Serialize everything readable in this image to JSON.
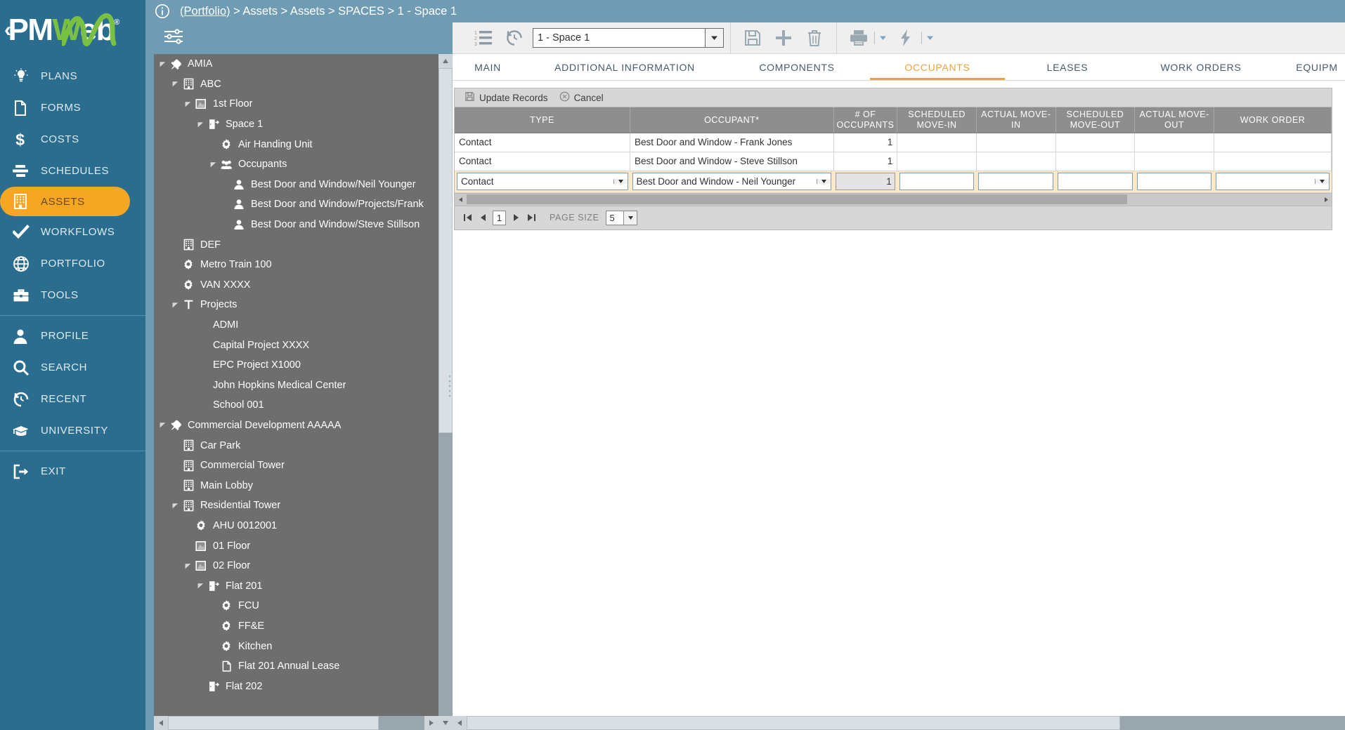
{
  "brand": {
    "name": "PMWeb",
    "chevron": "‹",
    "registered": "®",
    "accent_green": "#7ac143",
    "nav_background": "#2a6d8e",
    "active_background": "#f5a623"
  },
  "sidebar": {
    "items": [
      {
        "label": "PLANS",
        "icon": "lightbulb-icon",
        "active": false
      },
      {
        "label": "FORMS",
        "icon": "document-icon",
        "active": false
      },
      {
        "label": "COSTS",
        "icon": "dollar-icon",
        "active": false
      },
      {
        "label": "SCHEDULES",
        "icon": "gantt-bars-icon",
        "active": false
      },
      {
        "label": "ASSETS",
        "icon": "building-icon",
        "active": true
      },
      {
        "label": "WORKFLOWS",
        "icon": "checkmark-icon",
        "active": false
      },
      {
        "label": "PORTFOLIO",
        "icon": "globe-icon",
        "active": false
      },
      {
        "label": "TOOLS",
        "icon": "toolbox-icon",
        "active": false
      },
      {
        "label": "PROFILE",
        "icon": "person-icon",
        "active": false
      },
      {
        "label": "SEARCH",
        "icon": "magnifier-icon",
        "active": false
      },
      {
        "label": "RECENT",
        "icon": "history-clock-icon",
        "active": false
      },
      {
        "label": "UNIVERSITY",
        "icon": "graduation-cap-icon",
        "active": false
      },
      {
        "label": "EXIT",
        "icon": "logout-arrow-icon",
        "active": false
      }
    ]
  },
  "breadcrumb": {
    "info_icon": "info-circle-icon",
    "root": "(Portfolio)",
    "trail": " > Assets > Assets > SPACES > 1 - Space 1",
    "full": "(Portfolio) > Assets > Assets > SPACES > 1 - Space 1"
  },
  "tree_panel": {
    "filter_icon": "filter-sliders-icon",
    "nodes": [
      {
        "label": "AMIA",
        "indent": 0,
        "icon": "pin-icon",
        "arrow": "expanded"
      },
      {
        "label": "ABC",
        "indent": 1,
        "icon": "building-icon",
        "arrow": "expanded"
      },
      {
        "label": "1st Floor",
        "indent": 2,
        "icon": "floor-icon",
        "arrow": "expanded"
      },
      {
        "label": "Space 1",
        "indent": 3,
        "icon": "door-icon",
        "arrow": "expanded"
      },
      {
        "label": "Air Handing Unit",
        "indent": 4,
        "icon": "gear-icon",
        "arrow": "none"
      },
      {
        "label": "Occupants",
        "indent": 4,
        "icon": "people-icon",
        "arrow": "expanded"
      },
      {
        "label": "Best Door and Window/Neil Younger",
        "indent": 5,
        "icon": "person-icon",
        "arrow": "none"
      },
      {
        "label": "Best Door and Window/Projects/Frank",
        "indent": 5,
        "icon": "person-icon",
        "arrow": "none"
      },
      {
        "label": "Best Door and Window/Steve Stillson",
        "indent": 5,
        "icon": "person-icon",
        "arrow": "none"
      },
      {
        "label": "DEF",
        "indent": 1,
        "icon": "building-icon",
        "arrow": "none"
      },
      {
        "label": "Metro Train 100",
        "indent": 1,
        "icon": "gear-icon",
        "arrow": "none"
      },
      {
        "label": "VAN XXXX",
        "indent": 1,
        "icon": "gear-icon",
        "arrow": "none"
      },
      {
        "label": "Projects",
        "indent": 1,
        "icon": "tree-t-icon",
        "arrow": "expanded"
      },
      {
        "label": "ADMI",
        "indent": 2,
        "icon": "none",
        "arrow": "none"
      },
      {
        "label": "Capital Project XXXX",
        "indent": 2,
        "icon": "none",
        "arrow": "none"
      },
      {
        "label": "EPC Project X1000",
        "indent": 2,
        "icon": "none",
        "arrow": "none"
      },
      {
        "label": "John Hopkins Medical Center",
        "indent": 2,
        "icon": "none",
        "arrow": "none"
      },
      {
        "label": "School 001",
        "indent": 2,
        "icon": "none",
        "arrow": "none"
      },
      {
        "label": "Commercial Development AAAAA",
        "indent": 0,
        "icon": "pin-icon",
        "arrow": "expanded"
      },
      {
        "label": "Car Park",
        "indent": 1,
        "icon": "building-icon",
        "arrow": "none"
      },
      {
        "label": "Commercial Tower",
        "indent": 1,
        "icon": "building-icon",
        "arrow": "none"
      },
      {
        "label": "Main Lobby",
        "indent": 1,
        "icon": "building-icon",
        "arrow": "none"
      },
      {
        "label": "Residential Tower",
        "indent": 1,
        "icon": "building-icon",
        "arrow": "expanded"
      },
      {
        "label": "AHU 0012001",
        "indent": 2,
        "icon": "gear-icon",
        "arrow": "none"
      },
      {
        "label": "01 Floor",
        "indent": 2,
        "icon": "floor-icon",
        "arrow": "none"
      },
      {
        "label": "02 Floor",
        "indent": 2,
        "icon": "floor-icon",
        "arrow": "expanded"
      },
      {
        "label": "Flat 201",
        "indent": 3,
        "icon": "door-icon",
        "arrow": "expanded"
      },
      {
        "label": "FCU",
        "indent": 4,
        "icon": "gear-icon",
        "arrow": "none"
      },
      {
        "label": "FF&E",
        "indent": 4,
        "icon": "gear-icon",
        "arrow": "none"
      },
      {
        "label": "Kitchen",
        "indent": 4,
        "icon": "gear-icon",
        "arrow": "none"
      },
      {
        "label": "Flat 201 Annual Lease",
        "indent": 4,
        "icon": "lease-doc-icon",
        "arrow": "none"
      },
      {
        "label": "Flat 202",
        "indent": 3,
        "icon": "door-icon",
        "arrow": "none"
      }
    ]
  },
  "toolbar": {
    "list_icon": "numbered-list-icon",
    "history_icon": "history-clock-icon",
    "record_select": {
      "value": "1 - Space 1",
      "dropdown_icon": "chevron-down-icon"
    },
    "save_icon": "save-floppy-icon",
    "add_icon": "plus-icon",
    "delete_icon": "trash-icon",
    "print_icon": "printer-icon",
    "print_caret": "chevron-down-icon",
    "actions_icon": "lightning-bolt-icon",
    "actions_caret": "chevron-down-icon"
  },
  "tabs": [
    {
      "label": "MAIN",
      "active": false
    },
    {
      "label": "ADDITIONAL INFORMATION",
      "active": false
    },
    {
      "label": "COMPONENTS",
      "active": false
    },
    {
      "label": "OCCUPANTS",
      "active": true
    },
    {
      "label": "LEASES",
      "active": false
    },
    {
      "label": "WORK ORDERS",
      "active": false
    },
    {
      "label": "EQUIPM",
      "active": false
    }
  ],
  "grid": {
    "toolbar": {
      "update_label": "Update Records",
      "update_icon": "save-floppy-icon",
      "cancel_label": "Cancel",
      "cancel_icon": "cancel-circle-icon"
    },
    "columns": [
      "TYPE",
      "OCCUPANT*",
      "# OF OCCUPANTS",
      "SCHEDULED MOVE-IN",
      "ACTUAL MOVE-IN",
      "SCHEDULED MOVE-OUT",
      "ACTUAL MOVE-OUT",
      "WORK ORDER"
    ],
    "rows": [
      {
        "type": "Contact",
        "occupant": "Best Door and Window - Frank Jones",
        "num_occupants": "1",
        "scheduled_move_in": "",
        "actual_move_in": "",
        "scheduled_move_out": "",
        "actual_move_out": "",
        "work_order": ""
      },
      {
        "type": "Contact",
        "occupant": "Best Door and Window - Steve Stillson",
        "num_occupants": "1",
        "scheduled_move_in": "",
        "actual_move_in": "",
        "scheduled_move_out": "",
        "actual_move_out": "",
        "work_order": ""
      }
    ],
    "edit_row": {
      "type": "Contact",
      "occupant": "Best Door and Window - Neil Younger",
      "num_occupants": "1",
      "scheduled_move_in": "",
      "actual_move_in": "",
      "scheduled_move_out": "",
      "actual_move_out": "",
      "work_order": "",
      "dropdown_icon": "chevron-down-icon"
    },
    "pager": {
      "first_icon": "first-page-icon",
      "prev_icon": "prev-page-icon",
      "next_icon": "next-page-icon",
      "last_icon": "last-page-icon",
      "page": "1",
      "page_size_label": "PAGE SIZE",
      "page_size": "5",
      "page_size_caret": "chevron-down-icon"
    }
  }
}
